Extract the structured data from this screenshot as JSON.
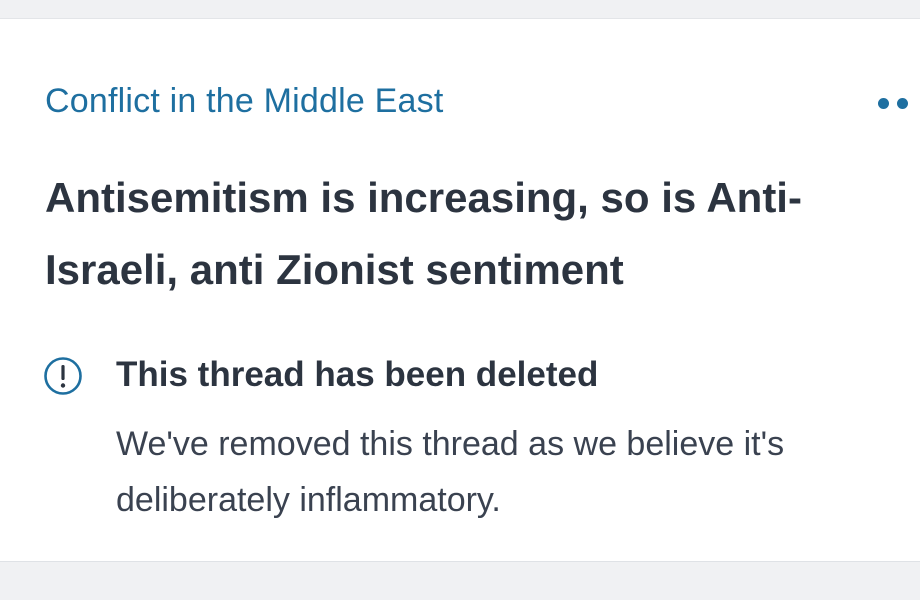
{
  "thread": {
    "topic": "Conflict in the Middle East",
    "title": "Antisemitism is increasing, so is Anti-Israeli, anti Zionist sentiment",
    "menu_icon": "more-options-icon"
  },
  "notice": {
    "icon": "info-alert-icon",
    "heading": "This thread has been deleted",
    "body": "We've removed this thread as we believe it's deliberately inflammatory."
  },
  "colors": {
    "accent": "#1e6fa0",
    "text": "#2c3440",
    "background": "#ffffff",
    "page_background": "#f0f1f3"
  }
}
